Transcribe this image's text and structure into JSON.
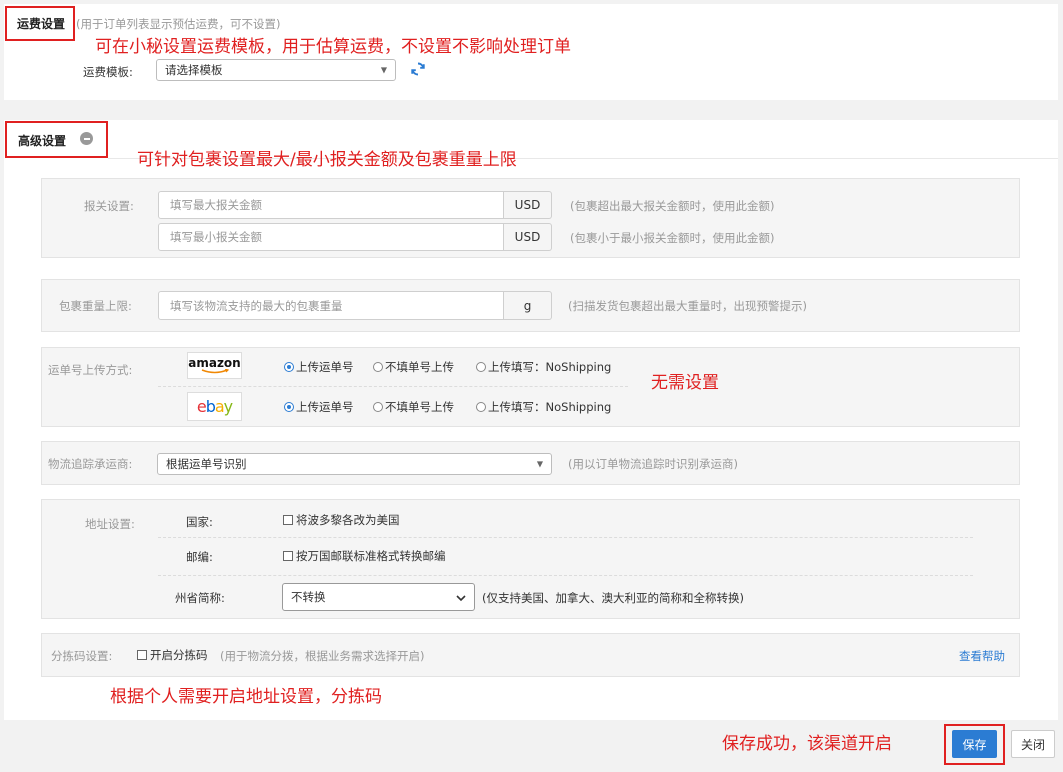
{
  "freight": {
    "title": "运费设置",
    "subtitle": "(用于订单列表显示预估运费，可不设置)",
    "template_label": "运费模板:",
    "template_value": "请选择模板",
    "annotation": "可在小秘设置运费模板，用于估算运费，不设置不影响处理订单"
  },
  "advanced": {
    "title": "高级设置",
    "annotation": "可针对包裹设置最大/最小报关金额及包裹重量上限"
  },
  "customs": {
    "label": "报关设置:",
    "max_placeholder": "填写最大报关金额",
    "min_placeholder": "填写最小报关金额",
    "currency": "USD",
    "max_hint": "(包裹超出最大报关金额时，使用此金额)",
    "min_hint": "(包裹小于最小报关金额时，使用此金额)"
  },
  "weight": {
    "label": "包裹重量上限:",
    "placeholder": "填写该物流支持的最大的包裹重量",
    "unit": "g",
    "hint": "(扫描发货包裹超出最大重量时，出现预警提示)"
  },
  "tracking_upload": {
    "label": "运单号上传方式:",
    "platforms": [
      {
        "name": "amazon",
        "options": [
          "上传运单号",
          "不填单号上传",
          "上传填写：NoShipping"
        ],
        "selected": 0
      },
      {
        "name": "ebay",
        "options": [
          "上传运单号",
          "不填单号上传",
          "上传填写：NoShipping"
        ],
        "selected": 0
      }
    ],
    "annotation": "无需设置"
  },
  "carrier": {
    "label": "物流追踪承运商:",
    "value": "根据运单号识别",
    "hint": "(用以订单物流追踪时识别承运商)"
  },
  "address": {
    "label": "地址设置:",
    "country_label": "国家:",
    "country_option": "将波多黎各改为美国",
    "zip_label": "邮编:",
    "zip_option": "按万国邮联标准格式转换邮编",
    "state_label": "州省简称:",
    "state_value": "不转换",
    "state_hint": "(仅支持美国、加拿大、澳大利亚的简称和全称转换)"
  },
  "sorting": {
    "label": "分拣码设置:",
    "option": "开启分拣码",
    "hint": "(用于物流分拨，根据业务需求选择开启)",
    "help_link": "查看帮助",
    "annotation": "根据个人需要开启地址设置，分拣码"
  },
  "footer": {
    "annotation": "保存成功，该渠道开启",
    "save_label": "保存",
    "close_label": "关闭"
  },
  "colors": {
    "annotation_red": "#e02020",
    "primary_blue": "#2b7cd3",
    "link_blue": "#2b7cd3"
  }
}
